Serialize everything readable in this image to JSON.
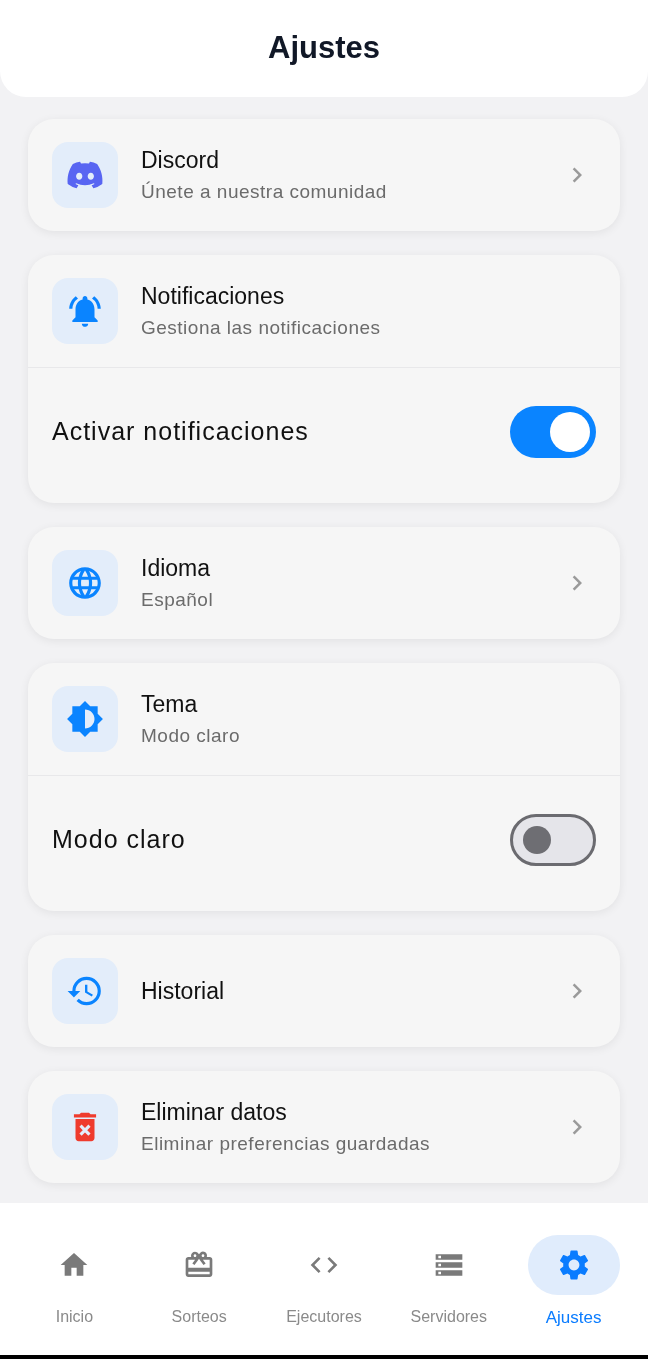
{
  "header": {
    "title": "Ajustes"
  },
  "sections": [
    {
      "title": "Discord",
      "subtitle": "Únete a nuestra comunidad",
      "chevron": true
    },
    {
      "title": "Notificaciones",
      "subtitle": "Gestiona las notificaciones",
      "chevron": false,
      "toggle": {
        "label": "Activar notificaciones",
        "on": true
      }
    },
    {
      "title": "Idioma",
      "subtitle": "Español",
      "chevron": true
    },
    {
      "title": "Tema",
      "subtitle": "Modo claro",
      "chevron": false,
      "toggle": {
        "label": "Modo claro",
        "on": false
      }
    },
    {
      "title": "Historial",
      "chevron": true
    },
    {
      "title": "Eliminar datos",
      "subtitle": "Eliminar preferencias guardadas",
      "chevron": true
    }
  ],
  "nav": [
    {
      "label": "Inicio",
      "selected": false
    },
    {
      "label": "Sorteos",
      "selected": false
    },
    {
      "label": "Ejecutores",
      "selected": false
    },
    {
      "label": "Servidores",
      "selected": false
    },
    {
      "label": "Ajustes",
      "selected": true
    }
  ]
}
